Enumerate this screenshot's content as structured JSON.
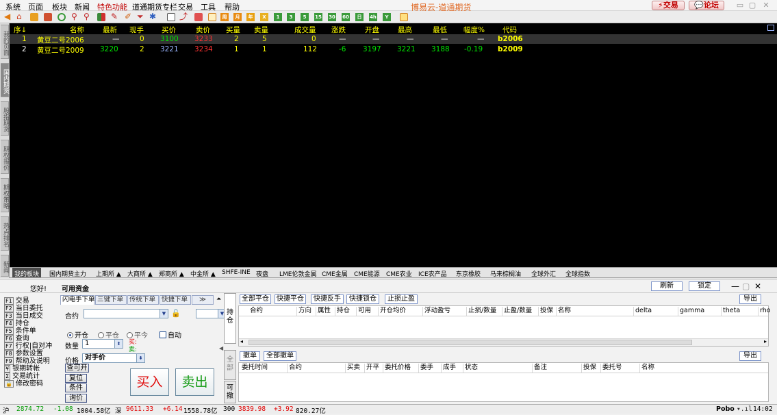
{
  "menu": {
    "items": [
      "系统",
      "页面",
      "板块",
      "新闻",
      "特色功能",
      "道通期货专栏",
      "交易",
      "工具",
      "帮助"
    ],
    "app_title": "博易云-道通期货",
    "trade_btn": "交易",
    "forum_btn": "论坛"
  },
  "toolbar": {
    "icons": [
      "back-icon",
      "home-icon",
      "folder-icon",
      "chart-icon",
      "refresh-icon",
      "search-icon",
      "search-plus-icon",
      "grid-icon",
      "pen-icon",
      "paint-icon",
      "filter-icon",
      "pin-icon",
      "window-icon",
      "line-chart-icon",
      "bar-chart-icon",
      "layout-icon",
      "calendar-icon",
      "notes-icon",
      "period-1m-icon",
      "period-5m-icon",
      "period-1-icon",
      "period-3-icon",
      "period-5-icon",
      "period-15-icon",
      "period-30-icon",
      "period-60-icon",
      "period-day-icon",
      "period-4h-icon",
      "period-year-icon",
      "table-icon"
    ],
    "period_labels": [
      "周",
      "月",
      "年",
      "X",
      "1",
      "3",
      "5",
      "15",
      "30",
      "60",
      "日",
      "4h",
      "Y"
    ]
  },
  "sidebar": {
    "tabs": [
      "我的页面",
      "国内期货",
      "股指期货",
      "期权报价",
      "期权策略",
      "热点排名",
      "新闻"
    ],
    "active": 1
  },
  "quote": {
    "headers": [
      "序↓",
      "名称",
      "最新",
      "现手",
      "买价",
      "卖价",
      "买量",
      "卖量",
      "成交量",
      "涨跌",
      "开盘",
      "最高",
      "最低",
      "幅度%",
      "代码"
    ],
    "rows": [
      {
        "seq": "1",
        "name": "黄豆二号2006",
        "last": "—",
        "vol": "0",
        "bid": "3100",
        "ask": "3233",
        "bidv": "2",
        "askv": "5",
        "volume": "0",
        "change": "—",
        "open": "—",
        "high": "—",
        "low": "—",
        "pct": "—",
        "code": "b2006"
      },
      {
        "seq": "2",
        "name": "黄豆二号2009",
        "last": "3220",
        "vol": "2",
        "bid": "3221",
        "ask": "3234",
        "bidv": "1",
        "askv": "1",
        "volume": "112",
        "change": "-6",
        "open": "3197",
        "high": "3221",
        "low": "3188",
        "pct": "-0.19",
        "code": "b2009"
      }
    ]
  },
  "bottom_tabs": [
    "我的板块",
    "国内期货主力",
    "上期所 ▲",
    "大商所 ▲",
    "郑商所 ▲",
    "中金所 ▲",
    "SHFE-INE",
    "夜盘",
    "LME伦敦金属",
    "CME金属",
    "CME能源",
    "CME农业",
    "ICE农产品",
    "东京橡胶",
    "马来棕榈油",
    "全球外汇",
    "全球指数"
  ],
  "trade": {
    "greeting": "您好!",
    "funds_label": "可用资金",
    "refresh": "刷新",
    "lock": "锁定",
    "functions": [
      {
        "key": "F1",
        "label": "交易"
      },
      {
        "key": "F2",
        "label": "当日委托"
      },
      {
        "key": "F3",
        "label": "当日成交"
      },
      {
        "key": "F4",
        "label": "持仓"
      },
      {
        "key": "F5",
        "label": "条件单"
      },
      {
        "key": "F6",
        "label": "查询"
      },
      {
        "key": "F7",
        "label": "行权|自对冲"
      },
      {
        "key": "F8",
        "label": "参数设置"
      },
      {
        "key": "F9",
        "label": "帮助及说明"
      },
      {
        "key": "¥",
        "label": "银期转帐"
      },
      {
        "key": "Σ",
        "label": "交易统计"
      },
      {
        "key": "🔒",
        "label": "修改密码"
      }
    ],
    "order_tabs": [
      "闪电手下单",
      "三键下单",
      "传统下单",
      "快捷下单"
    ],
    "contract_label": "合约",
    "open_label": "开仓",
    "close_label": "平仓",
    "closetoday_label": "平今",
    "auto_label": "自动",
    "qty_label": "数量",
    "qty_value": "1",
    "buy_hint": "买:",
    "sell_hint": "卖:",
    "price_label": "价格",
    "price_value": "对手价",
    "small_btns": [
      "查可开",
      "复位",
      "条件",
      "询价"
    ],
    "buy_btn": "买入",
    "sell_btn": "卖出",
    "pos_buttons": [
      "全部平仓",
      "快捷平仓",
      "快捷反手",
      "快捷锁仓",
      "止损止盈"
    ],
    "export": "导出",
    "vtabs": [
      "持仓",
      "全部",
      "可撤"
    ],
    "pos_cols": [
      "合约",
      "方向",
      "属性",
      "持仓",
      "可用",
      "开仓均价",
      "浮动盈亏",
      "止损/数量",
      "止盈/数量",
      "投保",
      "名称",
      "delta",
      "gamma",
      "theta",
      "rho"
    ],
    "order_buttons": [
      "撤单",
      "全部撤单"
    ],
    "order_cols": [
      "委托时间",
      "合约",
      "买卖",
      "开平",
      "委托价格",
      "委手",
      "成手",
      "状态",
      "备注",
      "投保",
      "委托号",
      "名称"
    ]
  },
  "status": {
    "sh_label": "沪",
    "sh_index": "2874.72",
    "sh_chg": "-1.08",
    "sh_amt": "1004.58亿",
    "sz_label": "深",
    "sz_index": "9611.33",
    "sz_chg": "+6.14",
    "sz_amt": "1558.78亿",
    "hs_label": "300",
    "hs_index": "3839.98",
    "hs_chg": "+3.92",
    "hs_amt": "820.27亿",
    "brand": "Pobo",
    "time": "14:02"
  },
  "colors": {
    "up": "#ff3232",
    "down": "#00e600",
    "neutral": "#ffffff",
    "code": "#ffff00",
    "header": "#ffff00"
  }
}
